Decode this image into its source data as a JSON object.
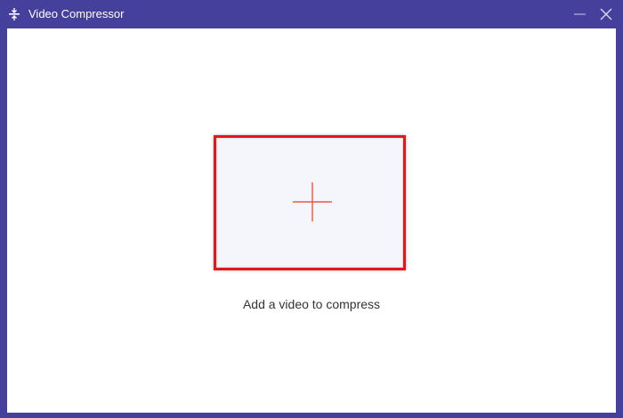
{
  "window": {
    "title": "Video Compressor",
    "frame_color": "#44409b",
    "icon": "compress-icon"
  },
  "controls": {
    "minimize_icon": "minimize-icon",
    "close_icon": "close-icon"
  },
  "drop_zone": {
    "icon": "plus-icon",
    "highlight_color": "#e3161b",
    "plus_color": "#f0553c"
  },
  "hint": {
    "text": "Add a video to compress"
  }
}
